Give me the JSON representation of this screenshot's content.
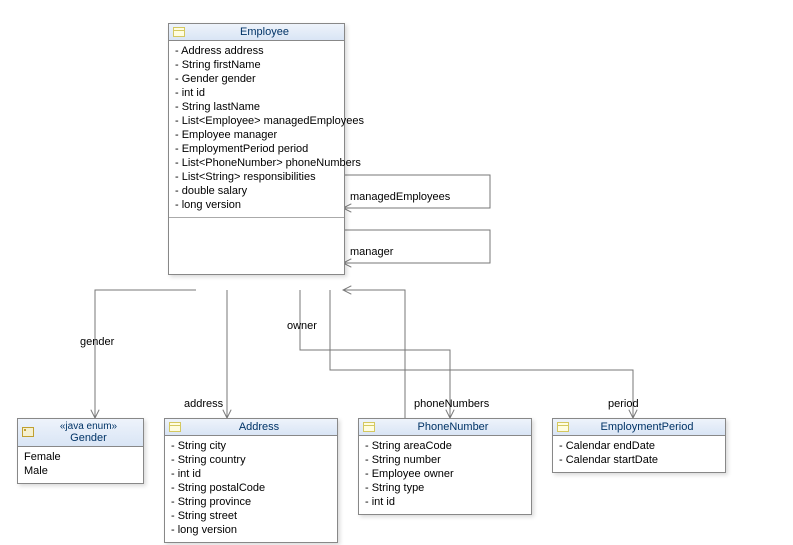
{
  "classes": {
    "employee": {
      "name": "Employee",
      "attrs": [
        "- Address address",
        "- String firstName",
        "- Gender gender",
        "- int id",
        "- String lastName",
        "- List<Employee> managedEmployees",
        "- Employee manager",
        "- EmploymentPeriod period",
        "- List<PhoneNumber> phoneNumbers",
        "- List<String> responsibilities",
        "- double salary",
        "- long version"
      ]
    },
    "gender": {
      "stereotype": "«java enum»",
      "name": "Gender",
      "attrs": [
        "Female",
        "Male"
      ]
    },
    "address": {
      "name": "Address",
      "attrs": [
        "- String city",
        "- String country",
        "- int id",
        "- String postalCode",
        "- String province",
        "- String street",
        "- long version"
      ]
    },
    "phoneNumber": {
      "name": "PhoneNumber",
      "attrs": [
        "- String areaCode",
        "- String number",
        "- Employee owner",
        "- String type",
        "- int id"
      ]
    },
    "employmentPeriod": {
      "name": "EmploymentPeriod",
      "attrs": [
        "- Calendar endDate",
        "- Calendar startDate"
      ]
    }
  },
  "edges": {
    "gender": "gender",
    "address": "address",
    "owner": "owner",
    "phoneNumbers": "phoneNumbers",
    "period": "period",
    "managedEmployees": "managedEmployees",
    "manager": "manager"
  },
  "chart_data": {
    "type": "uml_class_diagram",
    "classes": [
      {
        "name": "Employee",
        "attributes": [
          {
            "visibility": "-",
            "type": "Address",
            "name": "address"
          },
          {
            "visibility": "-",
            "type": "String",
            "name": "firstName"
          },
          {
            "visibility": "-",
            "type": "Gender",
            "name": "gender"
          },
          {
            "visibility": "-",
            "type": "int",
            "name": "id"
          },
          {
            "visibility": "-",
            "type": "String",
            "name": "lastName"
          },
          {
            "visibility": "-",
            "type": "List<Employee>",
            "name": "managedEmployees"
          },
          {
            "visibility": "-",
            "type": "Employee",
            "name": "manager"
          },
          {
            "visibility": "-",
            "type": "EmploymentPeriod",
            "name": "period"
          },
          {
            "visibility": "-",
            "type": "List<PhoneNumber>",
            "name": "phoneNumbers"
          },
          {
            "visibility": "-",
            "type": "List<String>",
            "name": "responsibilities"
          },
          {
            "visibility": "-",
            "type": "double",
            "name": "salary"
          },
          {
            "visibility": "-",
            "type": "long",
            "name": "version"
          }
        ]
      },
      {
        "name": "Gender",
        "stereotype": "java enum",
        "literals": [
          "Female",
          "Male"
        ]
      },
      {
        "name": "Address",
        "attributes": [
          {
            "visibility": "-",
            "type": "String",
            "name": "city"
          },
          {
            "visibility": "-",
            "type": "String",
            "name": "country"
          },
          {
            "visibility": "-",
            "type": "int",
            "name": "id"
          },
          {
            "visibility": "-",
            "type": "String",
            "name": "postalCode"
          },
          {
            "visibility": "-",
            "type": "String",
            "name": "province"
          },
          {
            "visibility": "-",
            "type": "String",
            "name": "street"
          },
          {
            "visibility": "-",
            "type": "long",
            "name": "version"
          }
        ]
      },
      {
        "name": "PhoneNumber",
        "attributes": [
          {
            "visibility": "-",
            "type": "String",
            "name": "areaCode"
          },
          {
            "visibility": "-",
            "type": "String",
            "name": "number"
          },
          {
            "visibility": "-",
            "type": "Employee",
            "name": "owner"
          },
          {
            "visibility": "-",
            "type": "String",
            "name": "type"
          },
          {
            "visibility": "-",
            "type": "int",
            "name": "id"
          }
        ]
      },
      {
        "name": "EmploymentPeriod",
        "attributes": [
          {
            "visibility": "-",
            "type": "Calendar",
            "name": "endDate"
          },
          {
            "visibility": "-",
            "type": "Calendar",
            "name": "startDate"
          }
        ]
      }
    ],
    "associations": [
      {
        "from": "Employee",
        "to": "Gender",
        "role": "gender",
        "navigable": "to"
      },
      {
        "from": "Employee",
        "to": "Address",
        "role": "address",
        "navigable": "to"
      },
      {
        "from": "PhoneNumber",
        "to": "Employee",
        "role": "owner",
        "navigable": "to"
      },
      {
        "from": "Employee",
        "to": "PhoneNumber",
        "role": "phoneNumbers",
        "navigable": "to"
      },
      {
        "from": "Employee",
        "to": "EmploymentPeriod",
        "role": "period",
        "navigable": "to"
      },
      {
        "from": "Employee",
        "to": "Employee",
        "role": "managedEmployees",
        "navigable": "to",
        "self": true
      },
      {
        "from": "Employee",
        "to": "Employee",
        "role": "manager",
        "navigable": "to",
        "self": true
      }
    ]
  }
}
